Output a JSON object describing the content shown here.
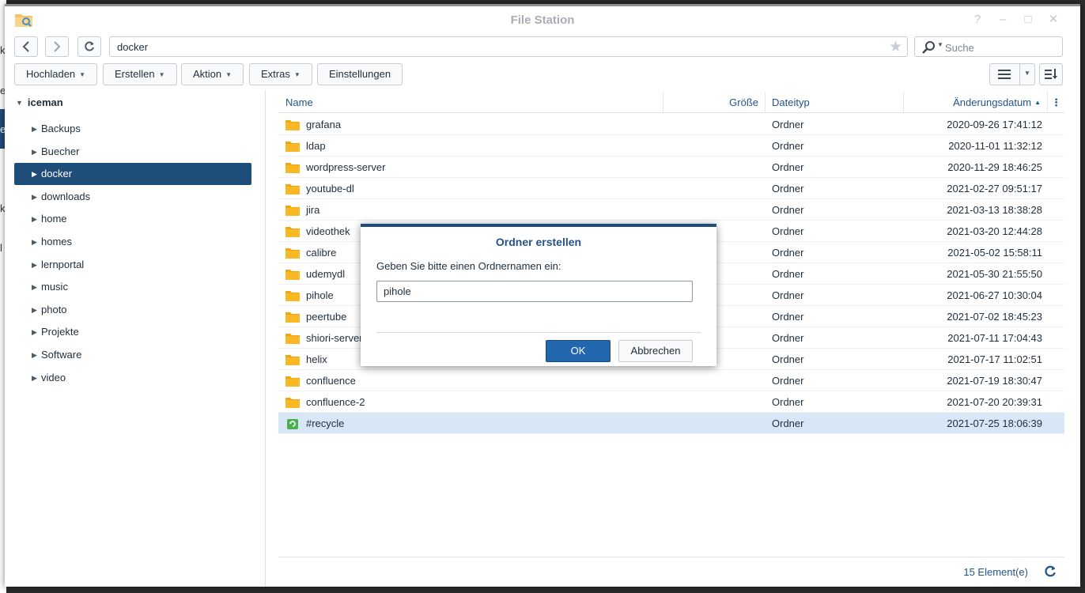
{
  "background_fragments": [
    "k",
    "er",
    "en",
    "k",
    "l"
  ],
  "window": {
    "title": "File Station",
    "controls": [
      "?",
      "–",
      "□",
      "✕"
    ]
  },
  "nav": {
    "path": "docker",
    "search_placeholder": "Suche"
  },
  "toolbar": {
    "upload": "Hochladen",
    "create": "Erstellen",
    "action": "Aktion",
    "extras": "Extras",
    "settings": "Einstellungen"
  },
  "sidebar": {
    "root": "iceman",
    "items": [
      {
        "label": "Backups"
      },
      {
        "label": "Buecher"
      },
      {
        "label": "docker",
        "selected": true
      },
      {
        "label": "downloads"
      },
      {
        "label": "home"
      },
      {
        "label": "homes"
      },
      {
        "label": "lernportal"
      },
      {
        "label": "music"
      },
      {
        "label": "photo"
      },
      {
        "label": "Projekte"
      },
      {
        "label": "Software"
      },
      {
        "label": "video"
      }
    ]
  },
  "table": {
    "columns": {
      "name": "Name",
      "size": "Größe",
      "type": "Dateityp",
      "modified": "Änderungsdatum"
    },
    "rows": [
      {
        "name": "grafana",
        "type": "Ordner",
        "modified": "2020-09-26 17:41:12"
      },
      {
        "name": "ldap",
        "type": "Ordner",
        "modified": "2020-11-01 11:32:12"
      },
      {
        "name": "wordpress-server",
        "type": "Ordner",
        "modified": "2020-11-29 18:46:25"
      },
      {
        "name": "youtube-dl",
        "type": "Ordner",
        "modified": "2021-02-27 09:51:17"
      },
      {
        "name": "jira",
        "type": "Ordner",
        "modified": "2021-03-13 18:38:28"
      },
      {
        "name": "videothek",
        "type": "Ordner",
        "modified": "2021-03-20 12:44:28"
      },
      {
        "name": "calibre",
        "type": "Ordner",
        "modified": "2021-05-02 15:58:11"
      },
      {
        "name": "udemydl",
        "type": "Ordner",
        "modified": "2021-05-30 21:55:50"
      },
      {
        "name": "pihole",
        "type": "Ordner",
        "modified": "2021-06-27 10:30:04"
      },
      {
        "name": "peertube",
        "type": "Ordner",
        "modified": "2021-07-02 18:45:23"
      },
      {
        "name": "shiori-server",
        "type": "Ordner",
        "modified": "2021-07-11 17:04:43"
      },
      {
        "name": "helix",
        "type": "Ordner",
        "modified": "2021-07-17 11:02:51"
      },
      {
        "name": "confluence",
        "type": "Ordner",
        "modified": "2021-07-19 18:30:47"
      },
      {
        "name": "confluence-2",
        "type": "Ordner",
        "modified": "2021-07-20 20:39:31"
      },
      {
        "name": "#recycle",
        "type": "Ordner",
        "modified": "2021-07-25 18:06:39",
        "recycle": true,
        "selected": true
      }
    ]
  },
  "footer": {
    "count": "15 Element(e)"
  },
  "dialog": {
    "title": "Ordner erstellen",
    "label": "Geben Sie bitte einen Ordnernamen ein:",
    "value": "pihole",
    "ok": "OK",
    "cancel": "Abbrechen"
  },
  "colors": {
    "accent": "#1f4d7a",
    "header_text": "#24538a",
    "folder": "#f7a81b",
    "recycle": "#4caf50",
    "selected_row": "#d7e7f5"
  }
}
